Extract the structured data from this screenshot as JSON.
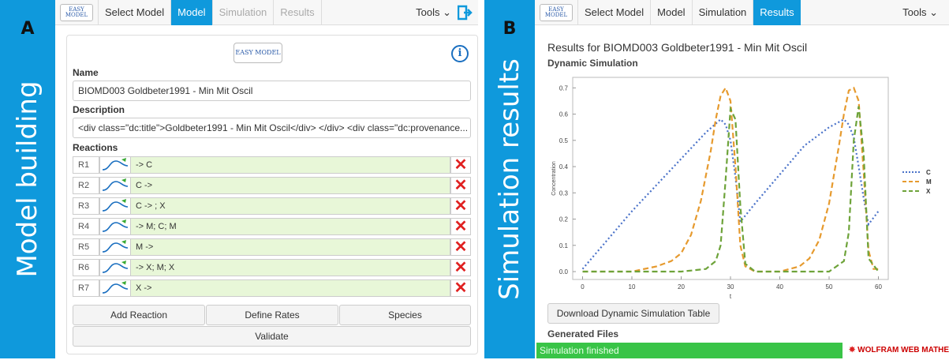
{
  "panel_a": {
    "letter": "A",
    "side_title": "Model building",
    "nav": {
      "logo_text": "EASY MODEL",
      "items": [
        {
          "label": "Select Model",
          "state": "normal"
        },
        {
          "label": "Model",
          "state": "active"
        },
        {
          "label": "Simulation",
          "state": "disabled"
        },
        {
          "label": "Results",
          "state": "disabled"
        }
      ],
      "tools_label": "Tools ⌄"
    },
    "logo_text": "EASY MODEL",
    "name_label": "Name",
    "name_value": "BIOMD003 Goldbeter1991 - Min Mit Oscil",
    "description_label": "Description",
    "description_value": "<div class=\"dc:title\">Goldbeter1991 - Min Mit Oscil</div> </div> <div class=\"dc:provenance...",
    "reactions_label": "Reactions",
    "reactions": [
      {
        "id": "R1",
        "equation": "-> C"
      },
      {
        "id": "R2",
        "equation": "C ->"
      },
      {
        "id": "R3",
        "equation": "C -> ; X"
      },
      {
        "id": "R4",
        "equation": "-> M; C; M"
      },
      {
        "id": "R5",
        "equation": "M ->"
      },
      {
        "id": "R6",
        "equation": "-> X; M; X"
      },
      {
        "id": "R7",
        "equation": "X ->"
      }
    ],
    "buttons": {
      "add_reaction": "Add Reaction",
      "define_rates": "Define Rates",
      "species": "Species",
      "validate": "Validate"
    },
    "icons": {
      "info": "info-icon",
      "delete": "delete-x-icon",
      "exit": "exit-icon",
      "kinetics": "kinetics-curve-icon"
    },
    "colors": {
      "accent": "#0f99dc",
      "reaction_bg": "#e8f7d8",
      "delete": "#e02020"
    }
  },
  "panel_b": {
    "letter": "B",
    "side_title": "Simulation results",
    "nav": {
      "logo_text": "EASY MODEL",
      "items": [
        {
          "label": "Select Model",
          "state": "normal"
        },
        {
          "label": "Model",
          "state": "normal"
        },
        {
          "label": "Simulation",
          "state": "normal"
        },
        {
          "label": "Results",
          "state": "active"
        }
      ],
      "tools_label": "Tools ⌄"
    },
    "results_title": "Results for BIOMD003 Goldbeter1991 - Min Mit Oscil",
    "dynamic_label": "Dynamic Simulation",
    "download_button": "Download Dynamic Simulation Table",
    "generated_files": "Generated Files",
    "status": "Simulation finished",
    "wolfram_text": "WOLFRAM WEB MATHEMATI",
    "colors": {
      "status_bg": "#39c447"
    }
  },
  "chart_data": {
    "type": "line",
    "xlabel": "t",
    "ylabel": "Concentration",
    "xlim": [
      -2,
      62
    ],
    "ylim": [
      -0.03,
      0.74
    ],
    "xticks": [
      0,
      10,
      20,
      30,
      40,
      50,
      60
    ],
    "yticks": [
      0.0,
      0.1,
      0.2,
      0.3,
      0.4,
      0.5,
      0.6,
      0.7
    ],
    "legend_position": "right",
    "series": [
      {
        "name": "C",
        "color": "#4a72c9",
        "dash": "dotted",
        "x": [
          0,
          5,
          10,
          15,
          20,
          25,
          28,
          29,
          30,
          31,
          32,
          35,
          40,
          45,
          50,
          53,
          54,
          55,
          56,
          57,
          58,
          60
        ],
        "y": [
          0.01,
          0.12,
          0.23,
          0.33,
          0.43,
          0.53,
          0.58,
          0.56,
          0.5,
          0.36,
          0.19,
          0.26,
          0.37,
          0.48,
          0.55,
          0.58,
          0.56,
          0.51,
          0.4,
          0.28,
          0.18,
          0.23
        ]
      },
      {
        "name": "M",
        "color": "#e69a2e",
        "dash": "dashed",
        "x": [
          0,
          10,
          15,
          18,
          20,
          22,
          24,
          26,
          27,
          28,
          29,
          30,
          31,
          32,
          33,
          35,
          40,
          44,
          46,
          48,
          50,
          52,
          53,
          54,
          55,
          56,
          57,
          58,
          59,
          60
        ],
        "y": [
          0.0,
          0.0,
          0.02,
          0.04,
          0.07,
          0.14,
          0.27,
          0.46,
          0.58,
          0.67,
          0.7,
          0.65,
          0.4,
          0.1,
          0.02,
          0.0,
          0.0,
          0.02,
          0.05,
          0.12,
          0.26,
          0.48,
          0.6,
          0.69,
          0.7,
          0.65,
          0.38,
          0.08,
          0.01,
          0.01
        ]
      },
      {
        "name": "X",
        "color": "#6ea33a",
        "dash": "dashed",
        "x": [
          0,
          20,
          25,
          27,
          28,
          29,
          30,
          31,
          32,
          33,
          35,
          50,
          53,
          54,
          55,
          56,
          57,
          58,
          60
        ],
        "y": [
          0.0,
          0.0,
          0.01,
          0.04,
          0.1,
          0.35,
          0.62,
          0.58,
          0.25,
          0.03,
          0.0,
          0.0,
          0.04,
          0.15,
          0.5,
          0.63,
          0.45,
          0.05,
          0.0
        ]
      }
    ]
  }
}
